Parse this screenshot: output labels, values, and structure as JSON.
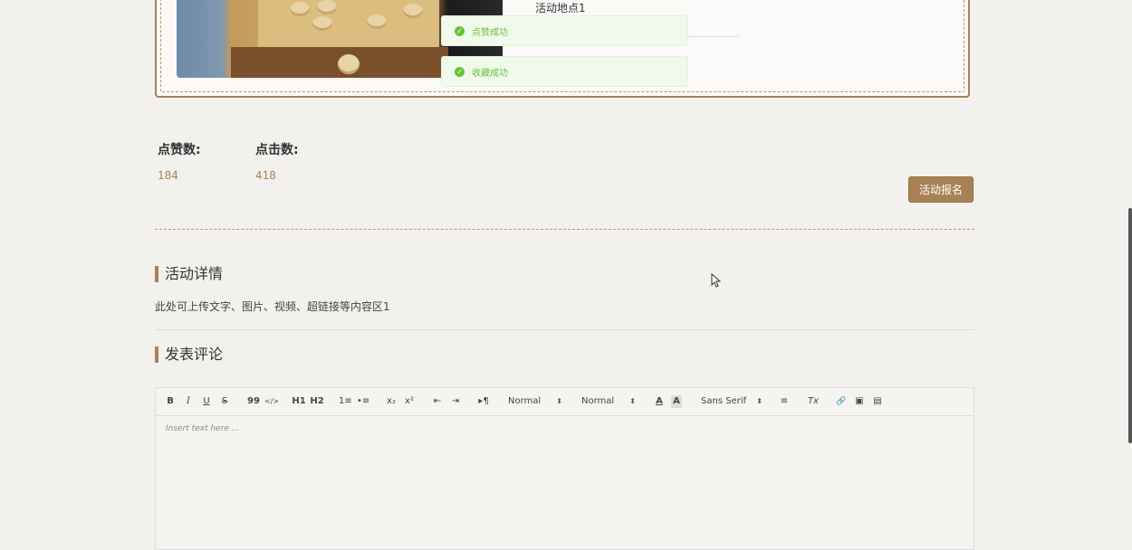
{
  "header_card": {
    "location_label": "活动地点1"
  },
  "toasts": [
    {
      "text": "点赞成功"
    },
    {
      "text": "收藏成功"
    }
  ],
  "stats": {
    "likes_label": "点赞数:",
    "likes_value": "184",
    "clicks_label": "点击数:",
    "clicks_value": "418"
  },
  "signup_button": "活动报名",
  "details": {
    "title": "活动详情",
    "body": "此处可上传文字、图片、视频、超链接等内容区1"
  },
  "comment": {
    "title": "发表评论",
    "editor": {
      "toolbar": {
        "bold": "B",
        "italic": "I",
        "underline": "U",
        "strike": "S",
        "blockquote": "99",
        "code": "</>",
        "h1": "H1",
        "h2": "H2",
        "ordered_list": "1≡",
        "bullet_list": "•≡",
        "subscript": "x₂",
        "superscript": "x²",
        "outdent": "⇤",
        "indent": "⇥",
        "direction": "▸¶",
        "size_select": "Normal",
        "header_select": "Normal",
        "font_color": "A",
        "background": "A",
        "font_select": "Sans Serif",
        "align": "≡",
        "clean": "Tx",
        "link": "🔗",
        "image": "▣",
        "video": "▤"
      },
      "placeholder": "Insert text here ..."
    }
  },
  "colors": {
    "accent": "#a88256",
    "success": "#67c23a",
    "background": "#f3f1ee"
  }
}
